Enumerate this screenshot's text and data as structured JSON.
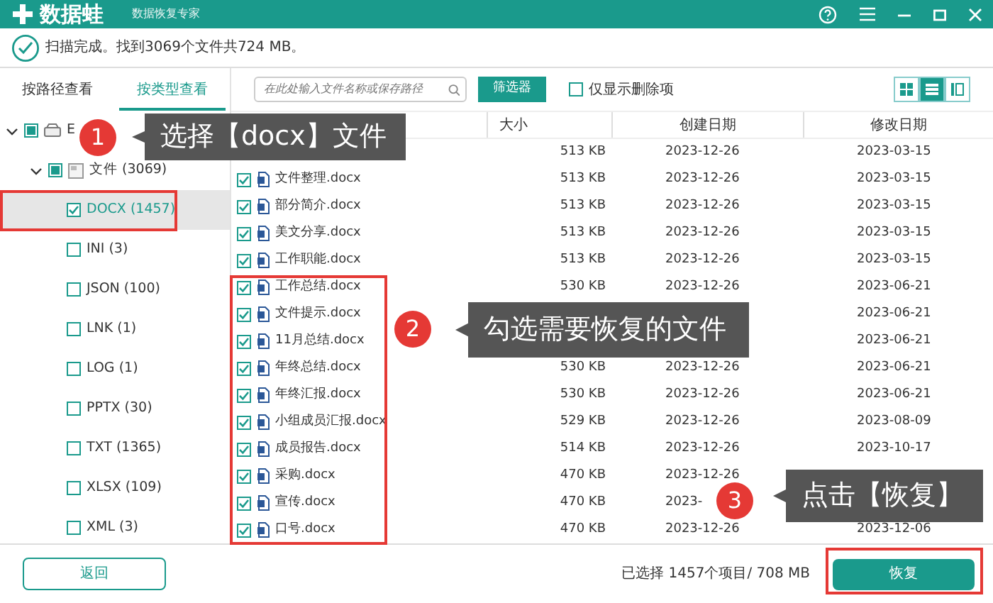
{
  "window": {
    "logo": "数据蛙",
    "subtitle": "数据恢复专家"
  },
  "scan_status": "扫描完成。找到3069个文件共724 MB。",
  "view_tabs": [
    {
      "label": "按路径查看",
      "selected": false
    },
    {
      "label": "按类型查看",
      "selected": true
    }
  ],
  "tree": [
    {
      "label": "E",
      "kind": "drive",
      "checked": false,
      "indeterminate": true,
      "expanded": true,
      "selected": false,
      "children": [
        {
          "label": "文件 (3069)",
          "kind": "folder",
          "checked": false,
          "indeterminate": true,
          "expanded": true,
          "selected": false,
          "children": [
            {
              "label": "DOCX (1457)",
              "kind": "type",
              "checked": true,
              "selected": true
            },
            {
              "label": "INI (3)",
              "kind": "type",
              "checked": false,
              "selected": false
            },
            {
              "label": "JSON (100)",
              "kind": "type",
              "checked": false,
              "selected": false
            },
            {
              "label": "LNK (1)",
              "kind": "type",
              "checked": false,
              "selected": false
            },
            {
              "label": "LOG (1)",
              "kind": "type",
              "checked": false,
              "selected": false
            },
            {
              "label": "PPTX (30)",
              "kind": "type",
              "checked": false,
              "selected": false
            },
            {
              "label": "TXT (1365)",
              "kind": "type",
              "checked": false,
              "selected": false
            },
            {
              "label": "XLSX (109)",
              "kind": "type",
              "checked": false,
              "selected": false
            },
            {
              "label": "XML (3)",
              "kind": "type",
              "checked": false,
              "selected": false
            }
          ]
        }
      ]
    }
  ],
  "search": {
    "placeholder": "在此处输入文件名称或保存路径"
  },
  "filter_button": "筛选器",
  "deleted_only": {
    "label": "仅显示删除项",
    "checked": false
  },
  "view_modes": [
    {
      "selected": false
    },
    {
      "selected": true
    },
    {
      "selected": false
    }
  ],
  "table": {
    "columns": [
      "大小",
      "创建日期",
      "修改日期"
    ],
    "rows": [
      {
        "size": "513 KB",
        "created": "2023-12-26",
        "modified": "2023-03-15"
      },
      {
        "checked": true,
        "name": "文件整理.docx",
        "size": "513 KB",
        "created": "2023-12-26",
        "modified": "2023-03-15"
      },
      {
        "checked": true,
        "name": "部分简介.docx",
        "size": "513 KB",
        "created": "2023-12-26",
        "modified": "2023-03-15"
      },
      {
        "checked": true,
        "name": "美文分享.docx",
        "size": "513 KB",
        "created": "2023-12-26",
        "modified": "2023-03-15"
      },
      {
        "checked": true,
        "name": "工作职能.docx",
        "size": "513 KB",
        "created": "2023-12-26",
        "modified": "2023-03-15"
      },
      {
        "checked": true,
        "name": "工作总结.docx",
        "size": "530 KB",
        "created": "2023-12-26",
        "modified": "2023-06-21"
      },
      {
        "checked": true,
        "name": "文件提示.docx",
        "modified": "2023-06-21"
      },
      {
        "checked": true,
        "name": "11月总结.docx",
        "modified": "2023-06-21"
      },
      {
        "checked": true,
        "name": "年终总结.docx",
        "size": "530 KB",
        "created": "2023-12-26",
        "modified": "2023-06-21"
      },
      {
        "checked": true,
        "name": "年终汇报.docx",
        "size": "530 KB",
        "created": "2023-12-26",
        "modified": "2023-06-21"
      },
      {
        "checked": true,
        "name": "小组成员汇报.docx",
        "size": "529 KB",
        "created": "2023-12-26",
        "modified": "2023-08-09"
      },
      {
        "checked": true,
        "name": "成员报告.docx",
        "size": "514 KB",
        "created": "2023-12-26",
        "modified": "2023-10-17"
      },
      {
        "checked": true,
        "name": "采购.docx",
        "size": "470 KB",
        "created": "2023-12-26"
      },
      {
        "checked": true,
        "name": "宣传.docx",
        "size": "470 KB",
        "created": "2023-"
      },
      {
        "checked": true,
        "name": "口号.docx",
        "size": "470 KB",
        "created": "2023-12-26",
        "modified": "2023-12-06"
      }
    ]
  },
  "footer": {
    "back_button": "返回",
    "selection_summary": "已选择 1457个项目/ 708 MB",
    "recover_button": "恢复"
  },
  "callouts": [
    {
      "number": "1",
      "text": "选择【docx】文件"
    },
    {
      "number": "2",
      "text": "勾选需要恢复的文件"
    },
    {
      "number": "3",
      "text": "点击【恢复】"
    }
  ]
}
